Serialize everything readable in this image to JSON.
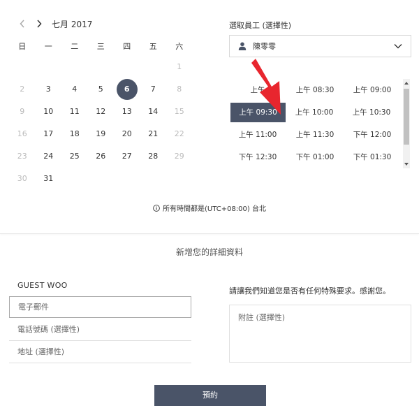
{
  "calendar": {
    "month_title": "七月 2017",
    "weekdays": [
      "日",
      "一",
      "二",
      "三",
      "四",
      "五",
      "六"
    ],
    "rows": [
      [
        {
          "d": "",
          "m": true
        },
        {
          "d": "",
          "m": true
        },
        {
          "d": "",
          "m": true
        },
        {
          "d": "",
          "m": true
        },
        {
          "d": "",
          "m": true
        },
        {
          "d": "",
          "m": true
        },
        {
          "d": "1",
          "m": true
        }
      ],
      [
        {
          "d": "2",
          "m": true
        },
        {
          "d": "3",
          "m": false
        },
        {
          "d": "4",
          "m": false
        },
        {
          "d": "5",
          "m": false
        },
        {
          "d": "6",
          "m": false,
          "s": true
        },
        {
          "d": "7",
          "m": false
        },
        {
          "d": "8",
          "m": true
        }
      ],
      [
        {
          "d": "9",
          "m": true
        },
        {
          "d": "10",
          "m": false
        },
        {
          "d": "11",
          "m": false
        },
        {
          "d": "12",
          "m": false
        },
        {
          "d": "13",
          "m": false
        },
        {
          "d": "14",
          "m": false
        },
        {
          "d": "15",
          "m": true
        }
      ],
      [
        {
          "d": "16",
          "m": true
        },
        {
          "d": "17",
          "m": false
        },
        {
          "d": "18",
          "m": false
        },
        {
          "d": "19",
          "m": false
        },
        {
          "d": "20",
          "m": false
        },
        {
          "d": "21",
          "m": false
        },
        {
          "d": "22",
          "m": true
        }
      ],
      [
        {
          "d": "23",
          "m": true
        },
        {
          "d": "24",
          "m": false
        },
        {
          "d": "25",
          "m": false
        },
        {
          "d": "26",
          "m": false
        },
        {
          "d": "27",
          "m": false
        },
        {
          "d": "28",
          "m": false
        },
        {
          "d": "29",
          "m": true
        }
      ],
      [
        {
          "d": "30",
          "m": true
        },
        {
          "d": "31",
          "m": false
        },
        {
          "d": "",
          "m": true
        },
        {
          "d": "",
          "m": true
        },
        {
          "d": "",
          "m": true
        },
        {
          "d": "",
          "m": true
        },
        {
          "d": "",
          "m": true
        }
      ]
    ]
  },
  "staff": {
    "label": "選取員工 (選擇性)",
    "selected": "陳零零"
  },
  "slots": [
    [
      "上午",
      "上午 08:30",
      "上午 09:00"
    ],
    [
      "上午 09:30",
      "上午 10:00",
      "上午 10:30"
    ],
    [
      "上午 11:00",
      "上午 11:30",
      "下午 12:00"
    ],
    [
      "下午 12:30",
      "下午 01:00",
      "下午 01:30"
    ]
  ],
  "selected_slot": "上午 09:30",
  "timezone": "所有時間都是(UTC+08:00) 台北",
  "details": {
    "title": "新增您的詳細資料",
    "guest_name": "GUEST WOO",
    "email_placeholder": "電子郵件",
    "phone_placeholder": "電話號碼 (選擇性)",
    "address_placeholder": "地址 (選擇性)",
    "note_label": "請讓我們知道您是否有任何特殊要求。感謝您。",
    "note_placeholder": "附註 (選擇性)"
  },
  "book_button": "預約",
  "colors": {
    "accent": "#4a5468",
    "arrow": "#e8262e",
    "muted_text": "#bbbbbb"
  }
}
